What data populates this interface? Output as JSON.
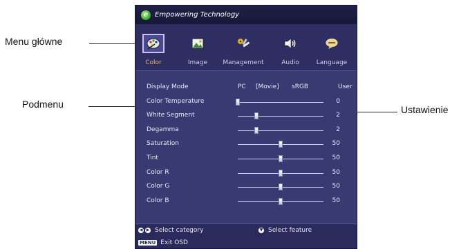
{
  "callouts": {
    "main_menu": "Menu główne",
    "submenu": "Podmenu",
    "setting": "Ustawienie"
  },
  "osd": {
    "brand": "Empowering Technology",
    "brand_logo_letter": "e",
    "tabs": [
      {
        "label": "Color",
        "icon": "palette-icon",
        "active": true
      },
      {
        "label": "Image",
        "icon": "picture-icon",
        "active": false
      },
      {
        "label": "Management",
        "icon": "tools-icon",
        "active": false
      },
      {
        "label": "Audio",
        "icon": "speaker-icon",
        "active": false
      },
      {
        "label": "Language",
        "icon": "speech-bubble-icon",
        "active": false
      }
    ],
    "display_mode": {
      "label": "Display Mode",
      "options": [
        "PC",
        "[Movie]",
        "sRGB",
        "User"
      ],
      "selected": "Movie"
    },
    "sliders": [
      {
        "label": "Color Temperature",
        "value": "0",
        "level": 0.0
      },
      {
        "label": "White Segment",
        "value": "2",
        "level": 0.22
      },
      {
        "label": "Degamma",
        "value": "2",
        "level": 0.22
      },
      {
        "label": "Saturation",
        "value": "50",
        "level": 0.5
      },
      {
        "label": "Tint",
        "value": "50",
        "level": 0.5
      },
      {
        "label": "Color R",
        "value": "50",
        "level": 0.5
      },
      {
        "label": "Color G",
        "value": "50",
        "level": 0.5
      },
      {
        "label": "Color B",
        "value": "50",
        "level": 0.5
      }
    ],
    "footer": {
      "select_category": "Select category",
      "select_feature": "Select feature",
      "menu_key": "MENU",
      "exit": "Exit OSD"
    }
  }
}
